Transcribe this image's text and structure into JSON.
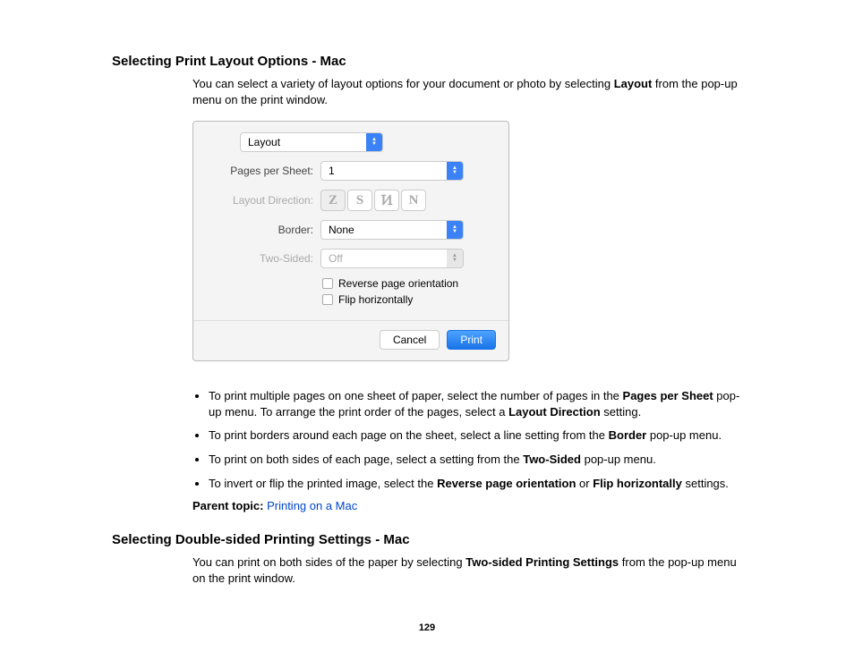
{
  "section1": {
    "heading": "Selecting Print Layout Options - Mac",
    "intro_a": "You can select a variety of layout options for your document or photo by selecting ",
    "intro_b": "Layout",
    "intro_c": " from the pop-up menu on the print window."
  },
  "dialog": {
    "main_select": "Layout",
    "labels": {
      "pages_per_sheet": "Pages per Sheet:",
      "layout_direction": "Layout Direction:",
      "border": "Border:",
      "two_sided": "Two-Sided:"
    },
    "values": {
      "pages_per_sheet": "1",
      "border": "None",
      "two_sided": "Off"
    },
    "segs": [
      "Z",
      "S",
      "Ͷ",
      "N"
    ],
    "checks": {
      "reverse": "Reverse page orientation",
      "flip": "Flip horizontally"
    },
    "buttons": {
      "cancel": "Cancel",
      "print": "Print"
    }
  },
  "bullets": {
    "b1a": "To print multiple pages on one sheet of paper, select the number of pages in the ",
    "b1b": "Pages per Sheet",
    "b1c": " pop-up menu. To arrange the print order of the pages, select a ",
    "b1d": "Layout Direction",
    "b1e": " setting.",
    "b2a": "To print borders around each page on the sheet, select a line setting from the ",
    "b2b": "Border",
    "b2c": " pop-up menu.",
    "b3a": "To print on both sides of each page, select a setting from the ",
    "b3b": "Two-Sided",
    "b3c": " pop-up menu.",
    "b4a": "To invert or flip the printed image, select the ",
    "b4b": "Reverse page orientation",
    "b4c": " or ",
    "b4d": "Flip horizontally",
    "b4e": " settings."
  },
  "parent": {
    "label": "Parent topic: ",
    "link": "Printing on a Mac"
  },
  "section2": {
    "heading": "Selecting Double-sided Printing Settings - Mac",
    "intro_a": "You can print on both sides of the paper by selecting ",
    "intro_b": "Two-sided Printing Settings",
    "intro_c": " from the pop-up menu on the print window."
  },
  "page_number": "129"
}
